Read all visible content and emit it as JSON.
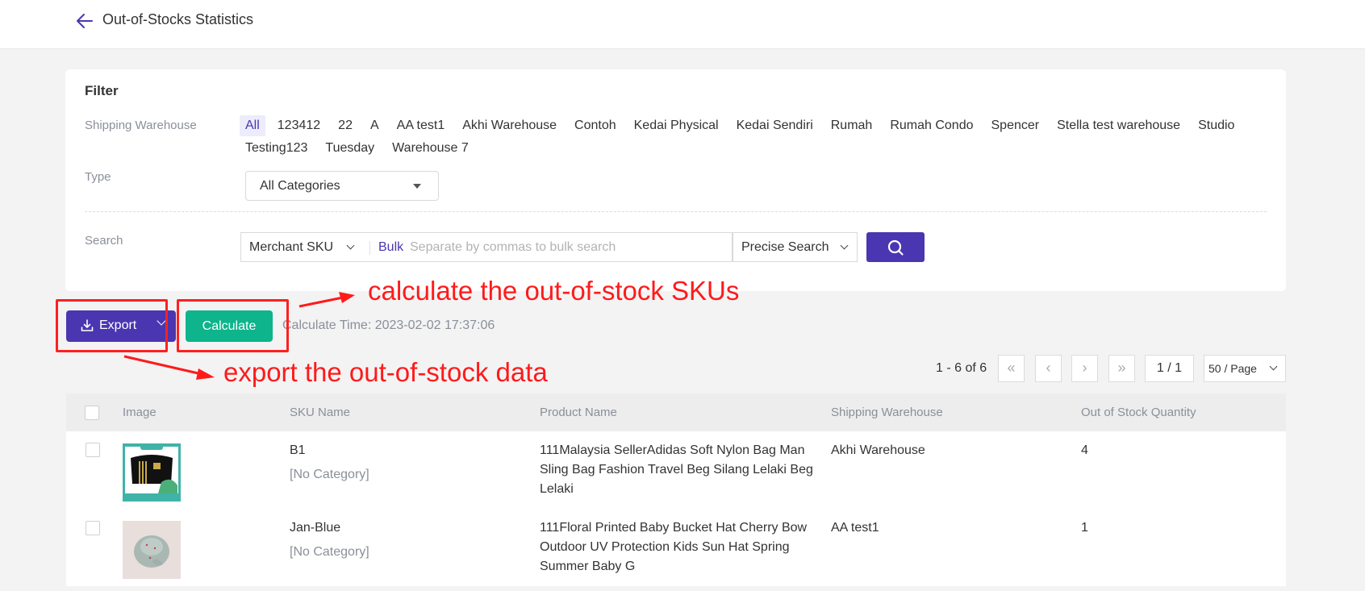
{
  "header": {
    "back_icon": "arrow-left-icon",
    "title": "Out-of-Stocks Statistics"
  },
  "filter": {
    "title": "Filter",
    "shipping_warehouse": {
      "label": "Shipping Warehouse",
      "options": [
        "All",
        "123412",
        "22",
        "A",
        "AA test1",
        "Akhi Warehouse",
        "Contoh",
        "Kedai Physical",
        "Kedai Sendiri",
        "Rumah",
        "Rumah Condo",
        "Spencer",
        "Stella test warehouse",
        "Studio",
        "Testing123",
        "Tuesday",
        "Warehouse 7"
      ],
      "selected": "All"
    },
    "type": {
      "label": "Type",
      "value": "All Categories"
    },
    "search": {
      "label": "Search",
      "field": "Merchant SKU",
      "bulk_label": "Bulk",
      "placeholder": "Separate by commas to bulk search",
      "value": "",
      "mode": "Precise Search",
      "button_icon": "search-icon"
    }
  },
  "actions": {
    "export_label": "Export",
    "export_icon": "download-icon",
    "calculate_label": "Calculate",
    "calculate_time": "Calculate Time: 2023-02-02 17:37:06"
  },
  "annotations": {
    "calculate_note": "calculate the out-of-stock SKUs",
    "export_note": "export the out-of-stock data",
    "color": "#ff1a1a"
  },
  "pagination": {
    "info": "1 - 6 of 6",
    "first": "«",
    "prev": "‹",
    "next": "›",
    "last": "»",
    "current": "1 / 1",
    "page_size": "50 / Page"
  },
  "table": {
    "columns": [
      "Image",
      "SKU Name",
      "Product Name",
      "Shipping Warehouse",
      "Out of Stock Quantity"
    ],
    "rows": [
      {
        "image": "black sling bag product photo",
        "sku_name": "B1",
        "category": "[No Category]",
        "product_name": "111Malaysia SellerAdidas Soft Nylon Bag Man Sling Bag Fashion Travel Beg Silang Lelaki Beg Lelaki",
        "warehouse": "Akhi Warehouse",
        "quantity": "4"
      },
      {
        "image": "baby bucket hat product photo",
        "sku_name": "Jan-Blue",
        "category": "[No Category]",
        "product_name": "111Floral Printed Baby Bucket Hat Cherry Bow Outdoor UV Protection Kids Sun Hat Spring Summer Baby G",
        "warehouse": "AA test1",
        "quantity": "1"
      }
    ]
  },
  "colors": {
    "primary": "#4a36b1",
    "calculate": "#0db48c",
    "background": "#f3f3f3"
  }
}
